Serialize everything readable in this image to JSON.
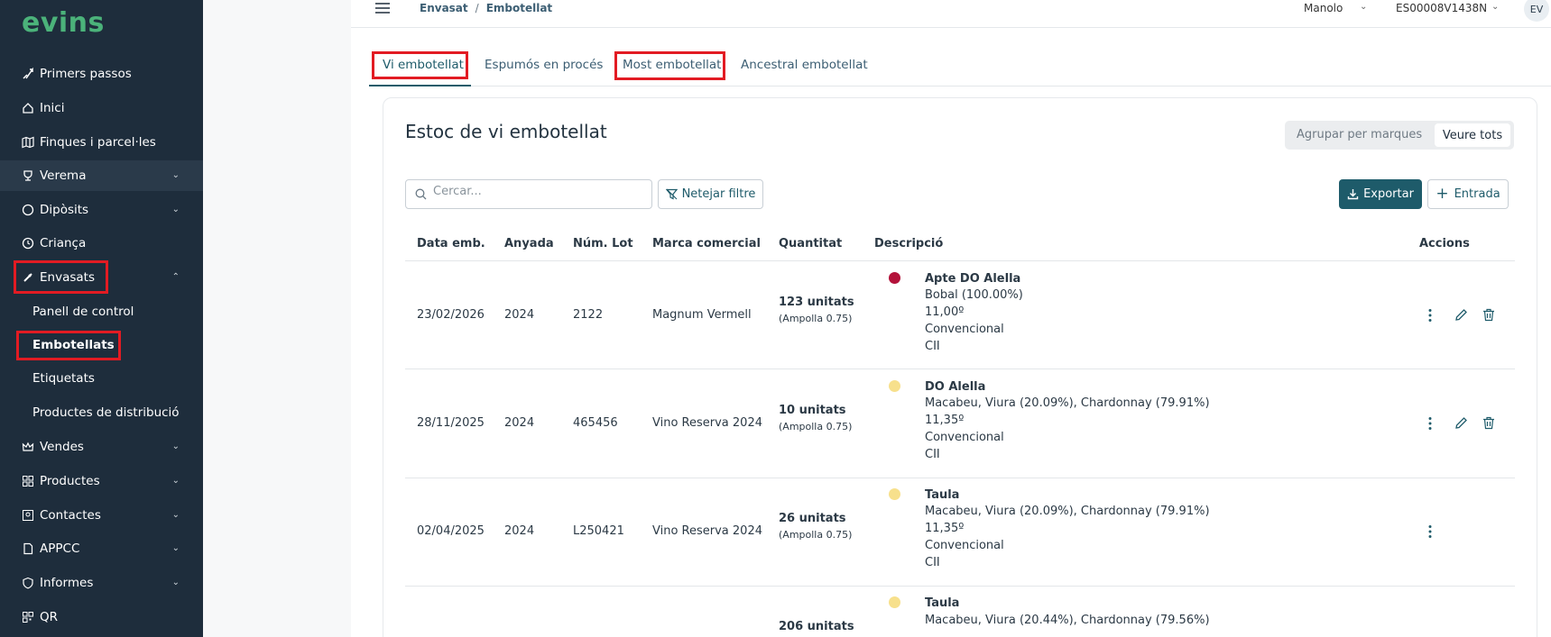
{
  "app": {
    "logo": "evins"
  },
  "sidebar": {
    "items": [
      {
        "label": "Primers passos"
      },
      {
        "label": "Inici"
      },
      {
        "label": "Finques i parcel·les"
      },
      {
        "label": "Verema"
      },
      {
        "label": "Dipòsits"
      },
      {
        "label": "Criança"
      },
      {
        "label": "Envasats"
      },
      {
        "label": "Vendes"
      },
      {
        "label": "Productes"
      },
      {
        "label": "Contactes"
      },
      {
        "label": "APPCC"
      },
      {
        "label": "Informes"
      },
      {
        "label": "QR"
      }
    ],
    "envasats_sub": [
      {
        "label": "Panell de control"
      },
      {
        "label": "Embotellats"
      },
      {
        "label": "Etiquetats"
      },
      {
        "label": "Productes de distribució"
      }
    ]
  },
  "header": {
    "breadcrumb_1": "Envasat",
    "breadcrumb_sep": "/",
    "breadcrumb_2": "Embotellat",
    "user": "Manolo",
    "company": "ES00008V1438N",
    "avatar": "EV"
  },
  "tabs": [
    {
      "label": "Vi embotellat"
    },
    {
      "label": "Espumós en procés"
    },
    {
      "label": "Most embotellat"
    },
    {
      "label": "Ancestral embotellat"
    }
  ],
  "card": {
    "title": "Estoc de vi embotellat",
    "group_by_label": "Agrupar per marques",
    "see_all_label": "Veure tots",
    "search_placeholder": "Cercar...",
    "clear_filter_label": "Netejar filtre",
    "export_label": "Exportar",
    "entry_label": "Entrada"
  },
  "table": {
    "columns": [
      "Data emb.",
      "Anyada",
      "Núm. Lot",
      "Marca comercial",
      "Quantitat",
      "Descripció",
      "Accions"
    ],
    "rows": [
      {
        "date": "23/02/2026",
        "vintage": "2024",
        "lot": "2122",
        "brand": "Magnum Vermell",
        "qty": "123 unitats",
        "qty_sub": "(Ampolla 0.75)",
        "dot_color": "#b3123a",
        "desc_title": "Apte DO Alella",
        "desc_1": "Bobal (100.00%)",
        "desc_2": "11,00º",
        "desc_3": "Convencional",
        "desc_4": "CII"
      },
      {
        "date": "28/11/2025",
        "vintage": "2024",
        "lot": "465456",
        "brand": "Vino Reserva 2024",
        "qty": "10 unitats",
        "qty_sub": "(Ampolla 0.75)",
        "dot_color": "#f7e08c",
        "desc_title": "DO Alella",
        "desc_1": "Macabeu, Viura (20.09%), Chardonnay (79.91%)",
        "desc_2": "11,35º",
        "desc_3": "Convencional",
        "desc_4": "CII"
      },
      {
        "date": "02/04/2025",
        "vintage": "2024",
        "lot": "L250421",
        "brand": "Vino Reserva 2024",
        "qty": "26 unitats",
        "qty_sub": "(Ampolla 0.75)",
        "dot_color": "#f7e08c",
        "desc_title": "Taula",
        "desc_1": "Macabeu, Viura (20.09%), Chardonnay (79.91%)",
        "desc_2": "11,35º",
        "desc_3": "Convencional",
        "desc_4": "CII"
      },
      {
        "date": "",
        "vintage": "",
        "lot": "",
        "brand": "",
        "qty": "206 unitats",
        "qty_sub": "",
        "dot_color": "#f7e08c",
        "desc_title": "Taula",
        "desc_1": "Macabeu, Viura (20.44%), Chardonnay (79.56%)",
        "desc_2": "",
        "desc_3": "",
        "desc_4": ""
      }
    ]
  },
  "colors": {
    "sidebar_bg": "#1e2d3c",
    "accent": "#1e5b6a",
    "highlight": "#e21b23",
    "logo": "#4bb27a"
  }
}
